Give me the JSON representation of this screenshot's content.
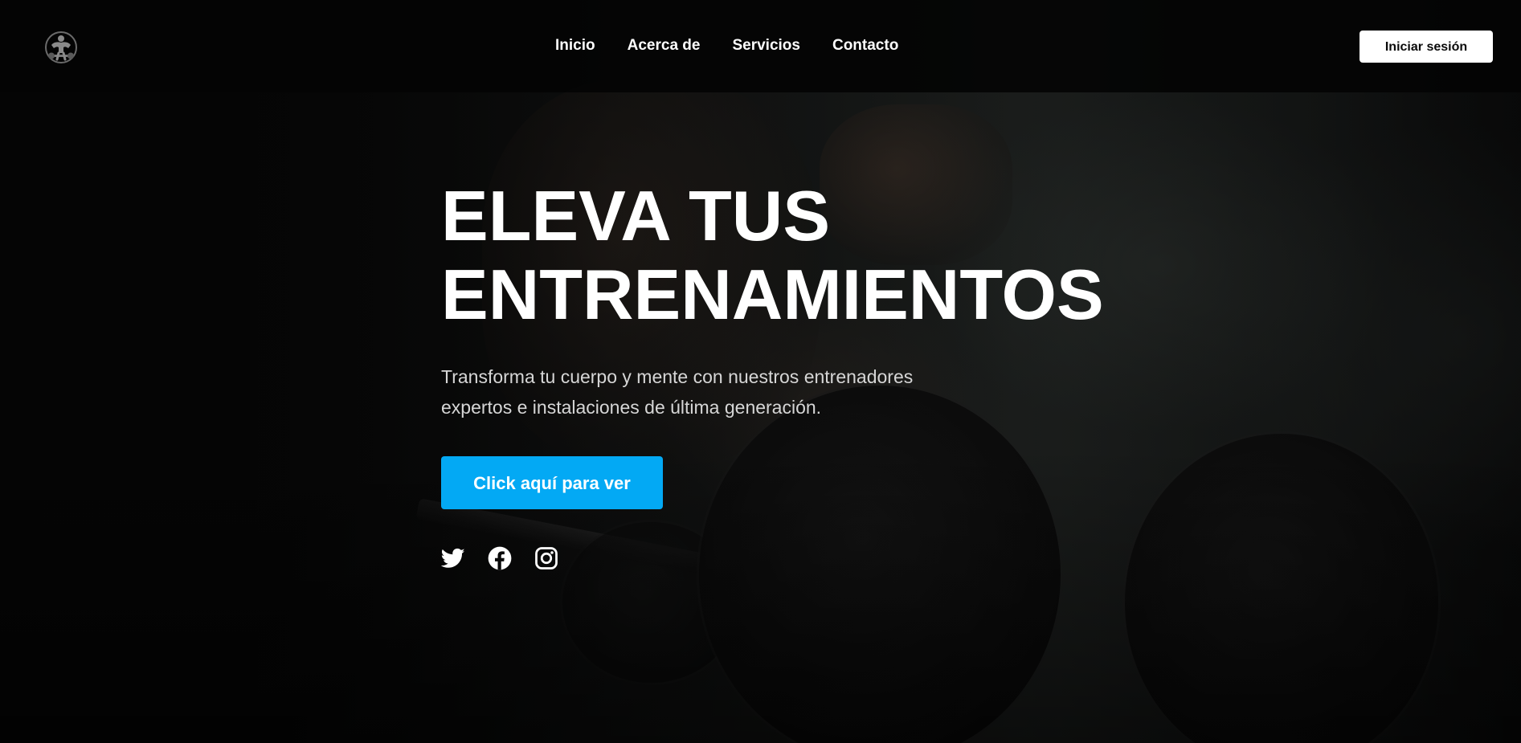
{
  "nav": {
    "logo_icon": "bodybuilder-logo-icon",
    "links": [
      {
        "label": "Inicio"
      },
      {
        "label": "Acerca de"
      },
      {
        "label": "Servicios"
      },
      {
        "label": "Contacto"
      }
    ],
    "login_label": "Iniciar sesión"
  },
  "hero": {
    "title_line1": "ELEVA TUS",
    "title_line2": "ENTRENAMIENTOS",
    "description": "Transforma tu cuerpo y mente con nuestros entrenadores expertos e instalaciones de última generación.",
    "cta_label": "Click aquí para ver",
    "social_icons": [
      "twitter-icon",
      "facebook-icon",
      "instagram-icon"
    ]
  },
  "colors": {
    "accent": "#03a9f4",
    "navbar_bg": "#040404",
    "text": "#ffffff",
    "muted_text": "#d6d6d6"
  }
}
